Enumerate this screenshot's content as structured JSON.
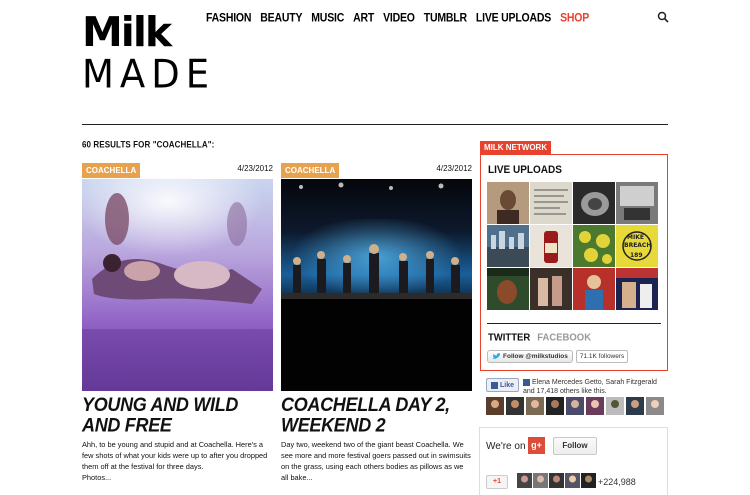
{
  "brand": {
    "line1": "Milk",
    "line2": "MADE"
  },
  "nav": [
    {
      "label": "FASHION"
    },
    {
      "label": "BEAUTY"
    },
    {
      "label": "MUSIC"
    },
    {
      "label": "ART"
    },
    {
      "label": "VIDEO"
    },
    {
      "label": "TUMBLR"
    },
    {
      "label": "LIVE UPLOADS"
    },
    {
      "label": "SHOP",
      "color": "#e8412e"
    }
  ],
  "search": {
    "icon": "search-icon"
  },
  "results": {
    "count_text": "60 RESULTS FOR \"COACHELLA\":"
  },
  "articles": [
    {
      "tag": "COACHELLA",
      "date": "4/23/2012",
      "title": "YOUNG AND WILD AND FREE",
      "excerpt": "Ahh, to be young and stupid and at Coachella. Here's a few shots of what your kids were up to after you dropped them off at the festival for three days.",
      "more": "Photos..."
    },
    {
      "tag": "COACHELLA",
      "date": "4/23/2012",
      "title": "COACHELLA DAY 2, WEEKEND 2",
      "excerpt": "Day two, weekend two of the giant beast Coachella. We see more and more festival goers passed out in swimsuits on the grass, using each others bodies as pillows as we all bake..."
    }
  ],
  "sidebar": {
    "network_label": "MILK NETWORK",
    "live_uploads_title": "LIVE UPLOADS",
    "tabs": [
      {
        "label": "TWITTER",
        "active": true
      },
      {
        "label": "FACEBOOK",
        "active": false
      }
    ],
    "twitter": {
      "follow_label": "Follow @milkstudios",
      "followers": "71.1K followers"
    },
    "facebook": {
      "like_label": "Like",
      "like_text": "Elena Mercedes Getto, Sarah Fitzgerald and 17,418 others like this."
    },
    "gplus": {
      "we_on": "We're on",
      "icon_text": "g+",
      "follow_label": "Follow",
      "plus_one": "+1",
      "count": "+224,988"
    }
  },
  "colors": {
    "accent_red": "#e8412e",
    "tag_orange": "#e8a24e",
    "facebook_blue": "#3b5998",
    "gplus_red": "#dd4b39"
  }
}
